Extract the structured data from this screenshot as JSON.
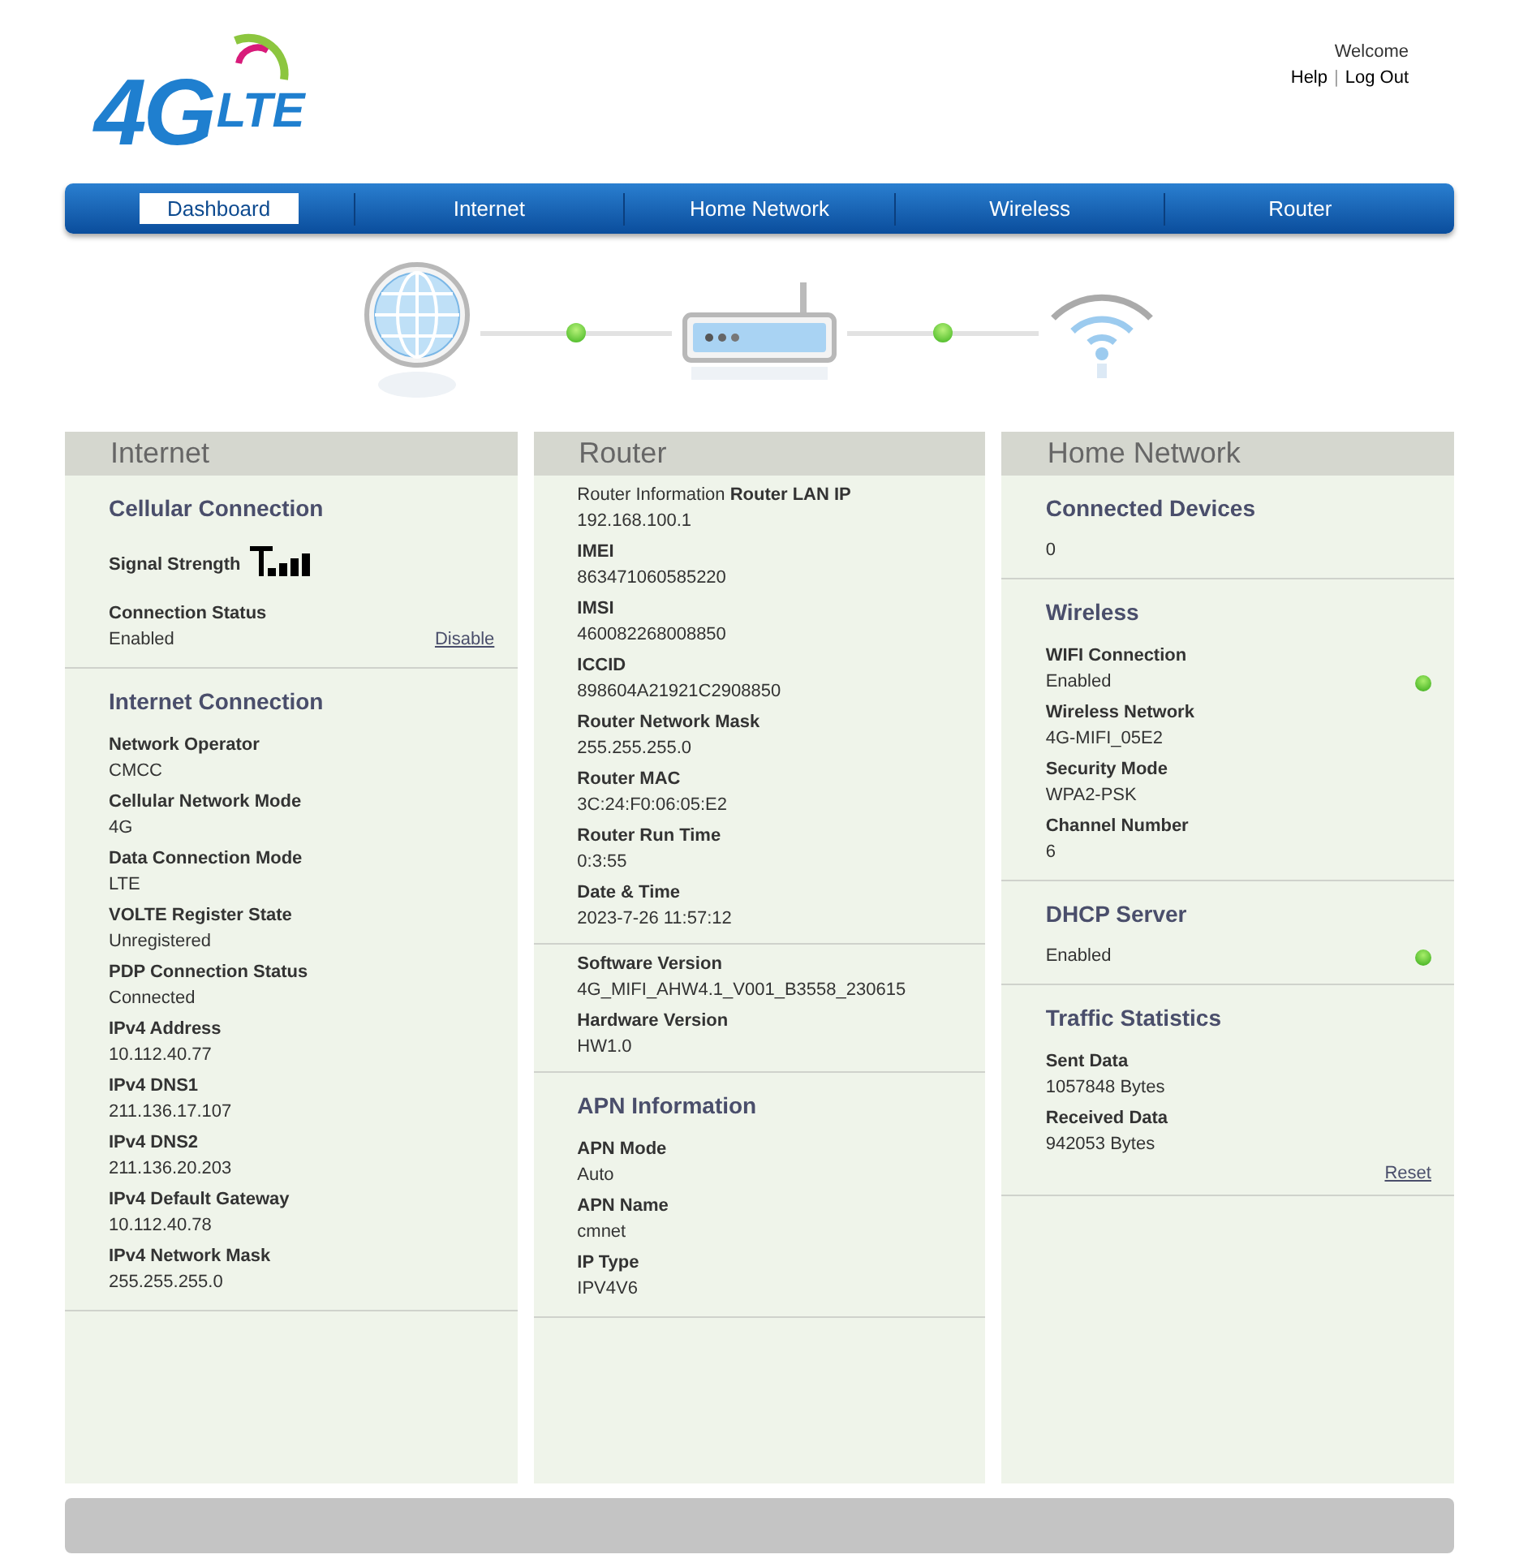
{
  "logo": {
    "main": "4G",
    "sub": "LTE"
  },
  "header": {
    "welcome": "Welcome",
    "links": [
      "Help",
      "Log Out"
    ],
    "separator": "|"
  },
  "tabs": [
    {
      "label": "Dashboard",
      "selected": true
    },
    {
      "label": "Internet",
      "selected": false
    },
    {
      "label": "Home Network",
      "selected": false
    },
    {
      "label": "Wireless",
      "selected": false
    },
    {
      "label": "Router",
      "selected": false
    }
  ],
  "diagram": {
    "links": [
      {
        "connected": true
      },
      {
        "connected": true
      }
    ]
  },
  "panels": [
    {
      "title": "Internet",
      "sections": [
        {
          "heading": "Cellular Connection",
          "items": [
            {
              "kind": "signal",
              "label": "Signal Strength"
            },
            {
              "kind": "field",
              "label": "Connection Status",
              "value": "Enabled",
              "action": "Disable"
            }
          ]
        },
        {
          "heading": "Internet Connection",
          "items": [
            {
              "kind": "field",
              "label": "Network Operator",
              "value": "CMCC"
            },
            {
              "kind": "field",
              "label": "Cellular Network Mode",
              "value": "4G"
            },
            {
              "kind": "field",
              "label": "Data Connection Mode",
              "value": "LTE"
            },
            {
              "kind": "field",
              "label": "VOLTE Register State",
              "value": "Unregistered"
            },
            {
              "kind": "field",
              "label": "PDP Connection Status",
              "value": "Connected"
            },
            {
              "kind": "field",
              "label": "IPv4 Address",
              "value": "10.112.40.77"
            },
            {
              "kind": "field",
              "label": "IPv4 DNS1",
              "value": "211.136.17.107"
            },
            {
              "kind": "field",
              "label": "IPv4 DNS2",
              "value": "211.136.20.203"
            },
            {
              "kind": "field",
              "label": "IPv4 Default Gateway",
              "value": "10.112.40.78"
            },
            {
              "kind": "field",
              "label": "IPv4 Network Mask",
              "value": "255.255.255.0"
            }
          ]
        }
      ]
    },
    {
      "title": "Router",
      "sections": [
        {
          "items": [
            {
              "kind": "captioned_field",
              "label": "Router Information **Router LAN IP**",
              "value": "192.168.100.1"
            },
            {
              "kind": "field",
              "label": "IMEI",
              "value": "863471060585220"
            },
            {
              "kind": "field",
              "label": "IMSI",
              "value": "460082268008850"
            },
            {
              "kind": "field",
              "label": "ICCID",
              "value": "898604A21921C2908850"
            },
            {
              "kind": "field",
              "label": "Router Network Mask",
              "value": "255.255.255.0"
            },
            {
              "kind": "field",
              "label": "Router MAC",
              "value": "3C:24:F0:06:05:E2"
            },
            {
              "kind": "field",
              "label": "Router Run Time",
              "value": "0:3:55"
            },
            {
              "kind": "field",
              "label": "Date & Time",
              "value": "2023-7-26 11:57:12"
            }
          ]
        },
        {
          "items": [
            {
              "kind": "field",
              "label": "Software Version",
              "value": "4G_MIFI_AHW4.1_V001_B3558_230615"
            },
            {
              "kind": "field",
              "label": "Hardware Version",
              "value": "HW1.0"
            }
          ]
        },
        {
          "heading": "APN Information",
          "items": [
            {
              "kind": "field",
              "label": "APN Mode",
              "value": "Auto"
            },
            {
              "kind": "field",
              "label": "APN Name",
              "value": "cmnet"
            },
            {
              "kind": "field",
              "label": "IP Type",
              "value": "IPV4V6"
            }
          ]
        }
      ]
    },
    {
      "title": "Home Network",
      "sections": [
        {
          "heading": "Connected Devices",
          "items": [
            {
              "kind": "value",
              "value": "0"
            }
          ]
        },
        {
          "heading": "Wireless",
          "items": [
            {
              "kind": "field",
              "label": "WIFI Connection",
              "value": "Enabled",
              "on": true
            },
            {
              "kind": "field",
              "label": "Wireless Network",
              "value": "4G-MIFI_05E2"
            },
            {
              "kind": "field",
              "label": "Security Mode",
              "value": "WPA2-PSK"
            },
            {
              "kind": "field",
              "label": "Channel Number",
              "value": "6"
            }
          ]
        },
        {
          "heading": "DHCP Server",
          "items": [
            {
              "kind": "value",
              "value": "Enabled",
              "on": true
            }
          ]
        },
        {
          "heading": "Traffic Statistics",
          "items": [
            {
              "kind": "field",
              "label": "Sent Data",
              "value": "1057848 Bytes"
            },
            {
              "kind": "field",
              "label": "Received Data",
              "value": "942053 Bytes",
              "action": "Reset"
            }
          ]
        }
      ]
    }
  ]
}
